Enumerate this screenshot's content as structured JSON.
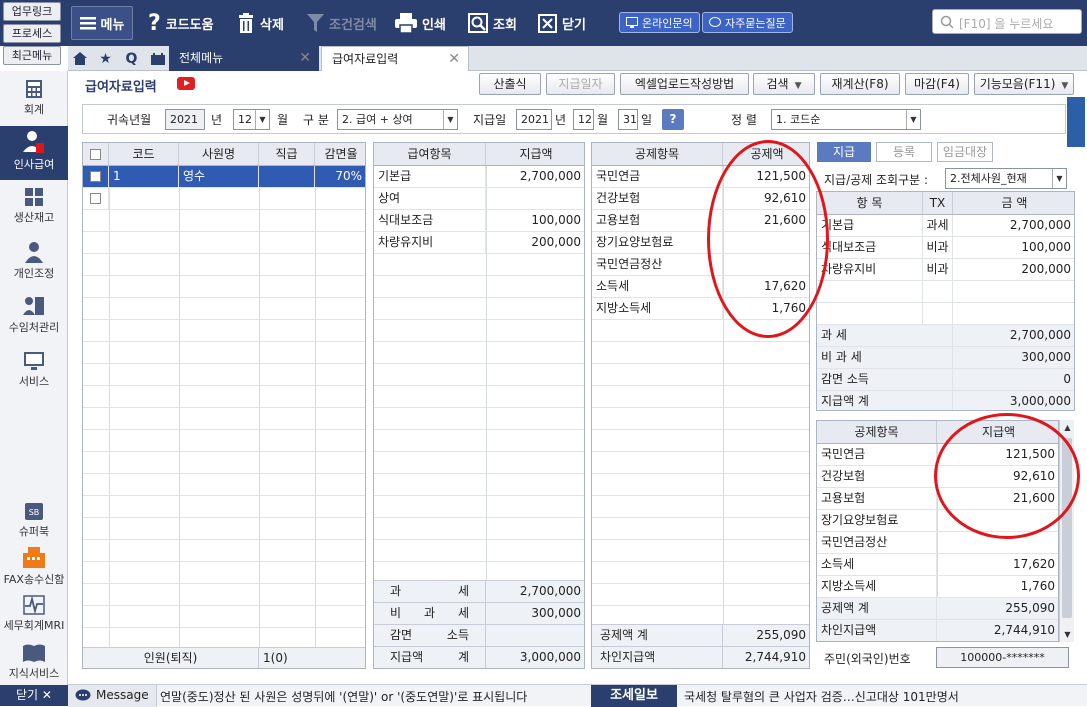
{
  "quick_links": [
    "업무링크",
    "프로세스",
    "최근메뉴"
  ],
  "toolbar": {
    "menu": "메뉴",
    "code_help": "코드도움",
    "delete": "삭제",
    "filter_search": "조건검색",
    "print": "인쇄",
    "lookup": "조회",
    "close": "닫기",
    "online_inquiry": "온라인문의",
    "faq": "자주묻는질문",
    "search_placeholder": "[F10] 을 누르세요"
  },
  "tabs": {
    "all_menu": "전체메뉴",
    "current": "급여자료입력"
  },
  "sidebar": [
    {
      "label": "회계",
      "icon": "calculator-icon"
    },
    {
      "label": "인사급여",
      "icon": "person-icon",
      "selected": true
    },
    {
      "label": "생산재고",
      "icon": "grid-icon"
    },
    {
      "label": "개인조정",
      "icon": "user-icon"
    },
    {
      "label": "수임처관리",
      "icon": "building-icon"
    },
    {
      "label": "서비스",
      "icon": "monitor-icon"
    },
    {
      "label": "슈퍼북",
      "icon": "sb-icon"
    },
    {
      "label": "FAX송수신함",
      "icon": "fax-icon"
    },
    {
      "label": "세무회계MRI",
      "icon": "pulse-icon"
    },
    {
      "label": "지식서비스",
      "icon": "book-icon"
    }
  ],
  "sidebar_close": "닫기 ✕",
  "page": {
    "title": "급여자료입력",
    "actions": [
      "산출식",
      "지급일자",
      "엑셀업로드작성방법",
      "검색",
      "재계산(F8)",
      "마감(F4)",
      "기능모음(F11)"
    ]
  },
  "filters": {
    "year_label": "귀속년월",
    "year": "2021",
    "year_unit": "년",
    "month": "12",
    "month_unit": "월",
    "category_label": "구 분",
    "category": "2. 급여 + 상여",
    "pay_date_label": "지급일",
    "pay_year": "2021",
    "pay_year_unit": "년",
    "pay_month": "12",
    "pay_month_unit": "월",
    "pay_day": "31",
    "pay_day_unit": "일",
    "help": "?",
    "sort_label": "정 렬",
    "sort": "1. 코드순"
  },
  "employees": {
    "headers": [
      "코드",
      "사원명",
      "직급",
      "감면율"
    ],
    "rows": [
      {
        "code": "1",
        "name": "영수",
        "rank": "",
        "reduction": "70%"
      }
    ],
    "footer_label": "인원(퇴직)",
    "footer_value": "1(0)"
  },
  "payments": {
    "headers": [
      "급여항목",
      "지급액"
    ],
    "rows": [
      {
        "item": "기본급",
        "amount": "2,700,000"
      },
      {
        "item": "상여",
        "amount": ""
      },
      {
        "item": "식대보조금",
        "amount": "100,000"
      },
      {
        "item": "차량유지비",
        "amount": "200,000"
      }
    ],
    "summary": [
      {
        "label": "과 세",
        "value": "2,700,000"
      },
      {
        "label": "비 과 세",
        "value": "300,000"
      },
      {
        "label": "감면 소득",
        "value": ""
      },
      {
        "label": "지급액 계",
        "value": "3,000,000"
      }
    ]
  },
  "deductions": {
    "headers": [
      "공제항목",
      "공제액"
    ],
    "rows": [
      {
        "item": "국민연금",
        "amount": "121,500"
      },
      {
        "item": "건강보험",
        "amount": "92,610"
      },
      {
        "item": "고용보험",
        "amount": "21,600"
      },
      {
        "item": "장기요양보험료",
        "amount": ""
      },
      {
        "item": "국민연금정산",
        "amount": ""
      },
      {
        "item": "소득세",
        "amount": "17,620"
      },
      {
        "item": "지방소득세",
        "amount": "1,760"
      }
    ],
    "summary": [
      {
        "label": "공제액 계",
        "value": "255,090"
      },
      {
        "label": "차인지급액",
        "value": "2,744,910"
      }
    ]
  },
  "right_panel": {
    "tabs": [
      "지급",
      "등록",
      "임금대장"
    ],
    "filter_label": "지급/공제 조회구분 :",
    "filter_value": "2.전체사원_현재",
    "pay_headers": [
      "항 목",
      "TX",
      "금 액"
    ],
    "pay_rows": [
      {
        "item": "기본급",
        "tx": "과세",
        "amount": "2,700,000"
      },
      {
        "item": "식대보조금",
        "tx": "비과",
        "amount": "100,000"
      },
      {
        "item": "차량유지비",
        "tx": "비과",
        "amount": "200,000"
      }
    ],
    "pay_summary": [
      {
        "label": "과 세",
        "value": "2,700,000"
      },
      {
        "label": "비 과 세",
        "value": "300,000"
      },
      {
        "label": "감면 소득",
        "value": "0"
      },
      {
        "label": "지급액 계",
        "value": "3,000,000"
      }
    ],
    "ded_headers": [
      "공제항목",
      "지급액"
    ],
    "ded_rows": [
      {
        "item": "국민연금",
        "amount": "121,500"
      },
      {
        "item": "건강보험",
        "amount": "92,610"
      },
      {
        "item": "고용보험",
        "amount": "21,600"
      },
      {
        "item": "장기요양보험료",
        "amount": ""
      },
      {
        "item": "국민연금정산",
        "amount": ""
      },
      {
        "item": "소득세",
        "amount": "17,620"
      },
      {
        "item": "지방소득세",
        "amount": "1,760"
      },
      {
        "item": "공제액 계",
        "amount": "255,090"
      },
      {
        "item": "차인지급액",
        "amount": "2,744,910"
      }
    ],
    "resident_label": "주민(외국인)번호",
    "resident_value": "100000-*******"
  },
  "statusbar": {
    "message_label": "Message",
    "message": "연말(중도)정산 된 사원은 성명뒤에 '(연말)' or '(중도연말)'로 표시됩니다",
    "news_label": "조세일보",
    "news": "국세청 탈루혐의 큰 사업자 검증…신고대상 101만명서"
  },
  "colors": {
    "navy": "#2b3f6e",
    "accent_blue": "#5c7ac0",
    "annotation_red": "#e0161b"
  }
}
